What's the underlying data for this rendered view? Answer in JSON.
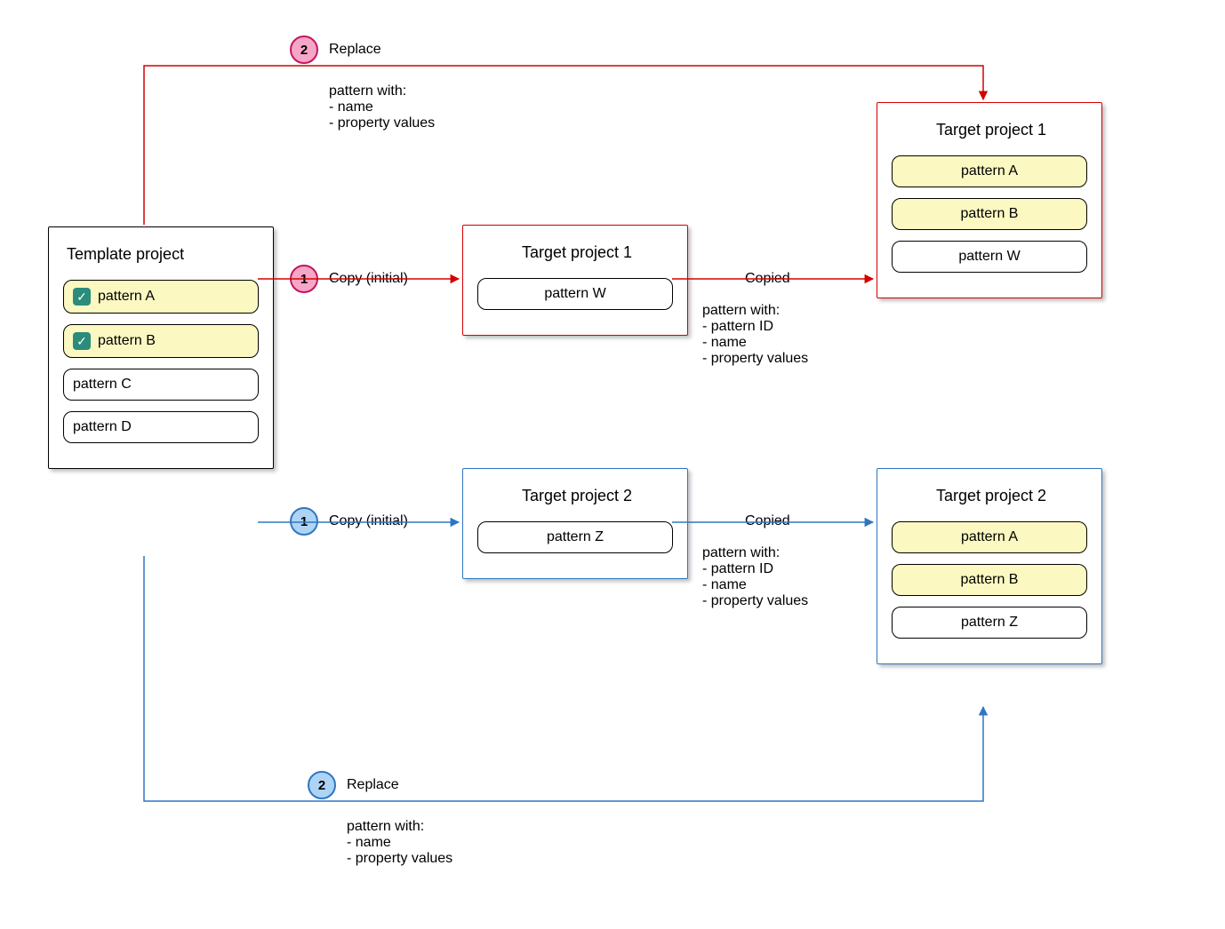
{
  "template": {
    "title": "Template project",
    "patterns": [
      "pattern A",
      "pattern B",
      "pattern C",
      "pattern D"
    ],
    "checked": [
      true,
      true,
      false,
      false
    ]
  },
  "targets_initial": [
    {
      "title": "Target project 1",
      "patterns": [
        "pattern W"
      ]
    },
    {
      "title": "Target project 2",
      "patterns": [
        "pattern Z"
      ]
    }
  ],
  "targets_final": [
    {
      "title": "Target project 1",
      "patterns": [
        "pattern A",
        "pattern B",
        "pattern W"
      ],
      "yellow": [
        true,
        true,
        false
      ]
    },
    {
      "title": "Target project 2",
      "patterns": [
        "pattern A",
        "pattern B",
        "pattern Z"
      ],
      "yellow": [
        true,
        true,
        false
      ]
    }
  ],
  "steps": {
    "copy_label": "Copy (initial)",
    "replace_label": "Replace",
    "copied_label": "Copied",
    "copied_detail": "pattern with:\n- pattern ID\n- name\n- property values",
    "replace_detail": "pattern with:\n- name\n- property values",
    "badge1": "1",
    "badge2": "2"
  }
}
